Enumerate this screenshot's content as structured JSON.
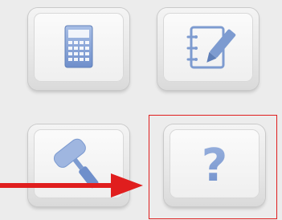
{
  "buttons": [
    {
      "id": "calculator",
      "icon": "calculator-icon"
    },
    {
      "id": "notes",
      "icon": "notepad-pencil-icon"
    },
    {
      "id": "paint",
      "icon": "paint-roller-icon"
    },
    {
      "id": "help",
      "icon": "question-mark-icon",
      "highlighted": true
    }
  ],
  "colors": {
    "icon": "#7d9bd0",
    "icon_dark": "#5f7fb8",
    "highlight": "#e01e1e"
  },
  "help_glyph": "?"
}
